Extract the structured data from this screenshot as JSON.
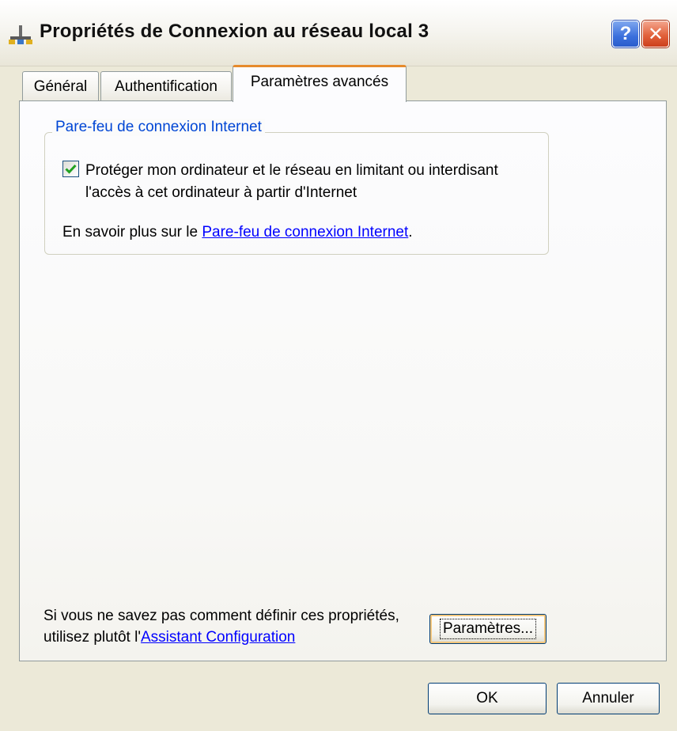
{
  "window": {
    "title": "Propriétés de Connexion au réseau local 3",
    "help_label": "?",
    "close_label": "✕"
  },
  "tabs": [
    {
      "label": "Général",
      "selected": false
    },
    {
      "label": "Authentification",
      "selected": false
    },
    {
      "label": "Paramètres avancés",
      "selected": true
    }
  ],
  "firewall_group": {
    "title": "Pare-feu de connexion Internet",
    "checkbox_checked": true,
    "checkbox_label": "Protéger mon ordinateur et le réseau en limitant ou interdisant l'accès à cet ordinateur à partir d'Internet",
    "learn_prefix": "En savoir plus sur le ",
    "learn_link": "Pare-feu de connexion Internet",
    "learn_suffix": "."
  },
  "assistant": {
    "text_prefix": "Si vous ne savez pas comment définir ces propriétés, utilisez plutôt l'",
    "link": "Assistant Configuration",
    "settings_button": "Paramètres..."
  },
  "footer": {
    "ok_label": "OK",
    "cancel_label": "Annuler"
  },
  "colors": {
    "dialog_bg": "#ece9d8",
    "group_title": "#0046d5",
    "link": "#0000ff",
    "selected_tab_accent": "#e68b2c",
    "checkmark": "#21a121"
  }
}
